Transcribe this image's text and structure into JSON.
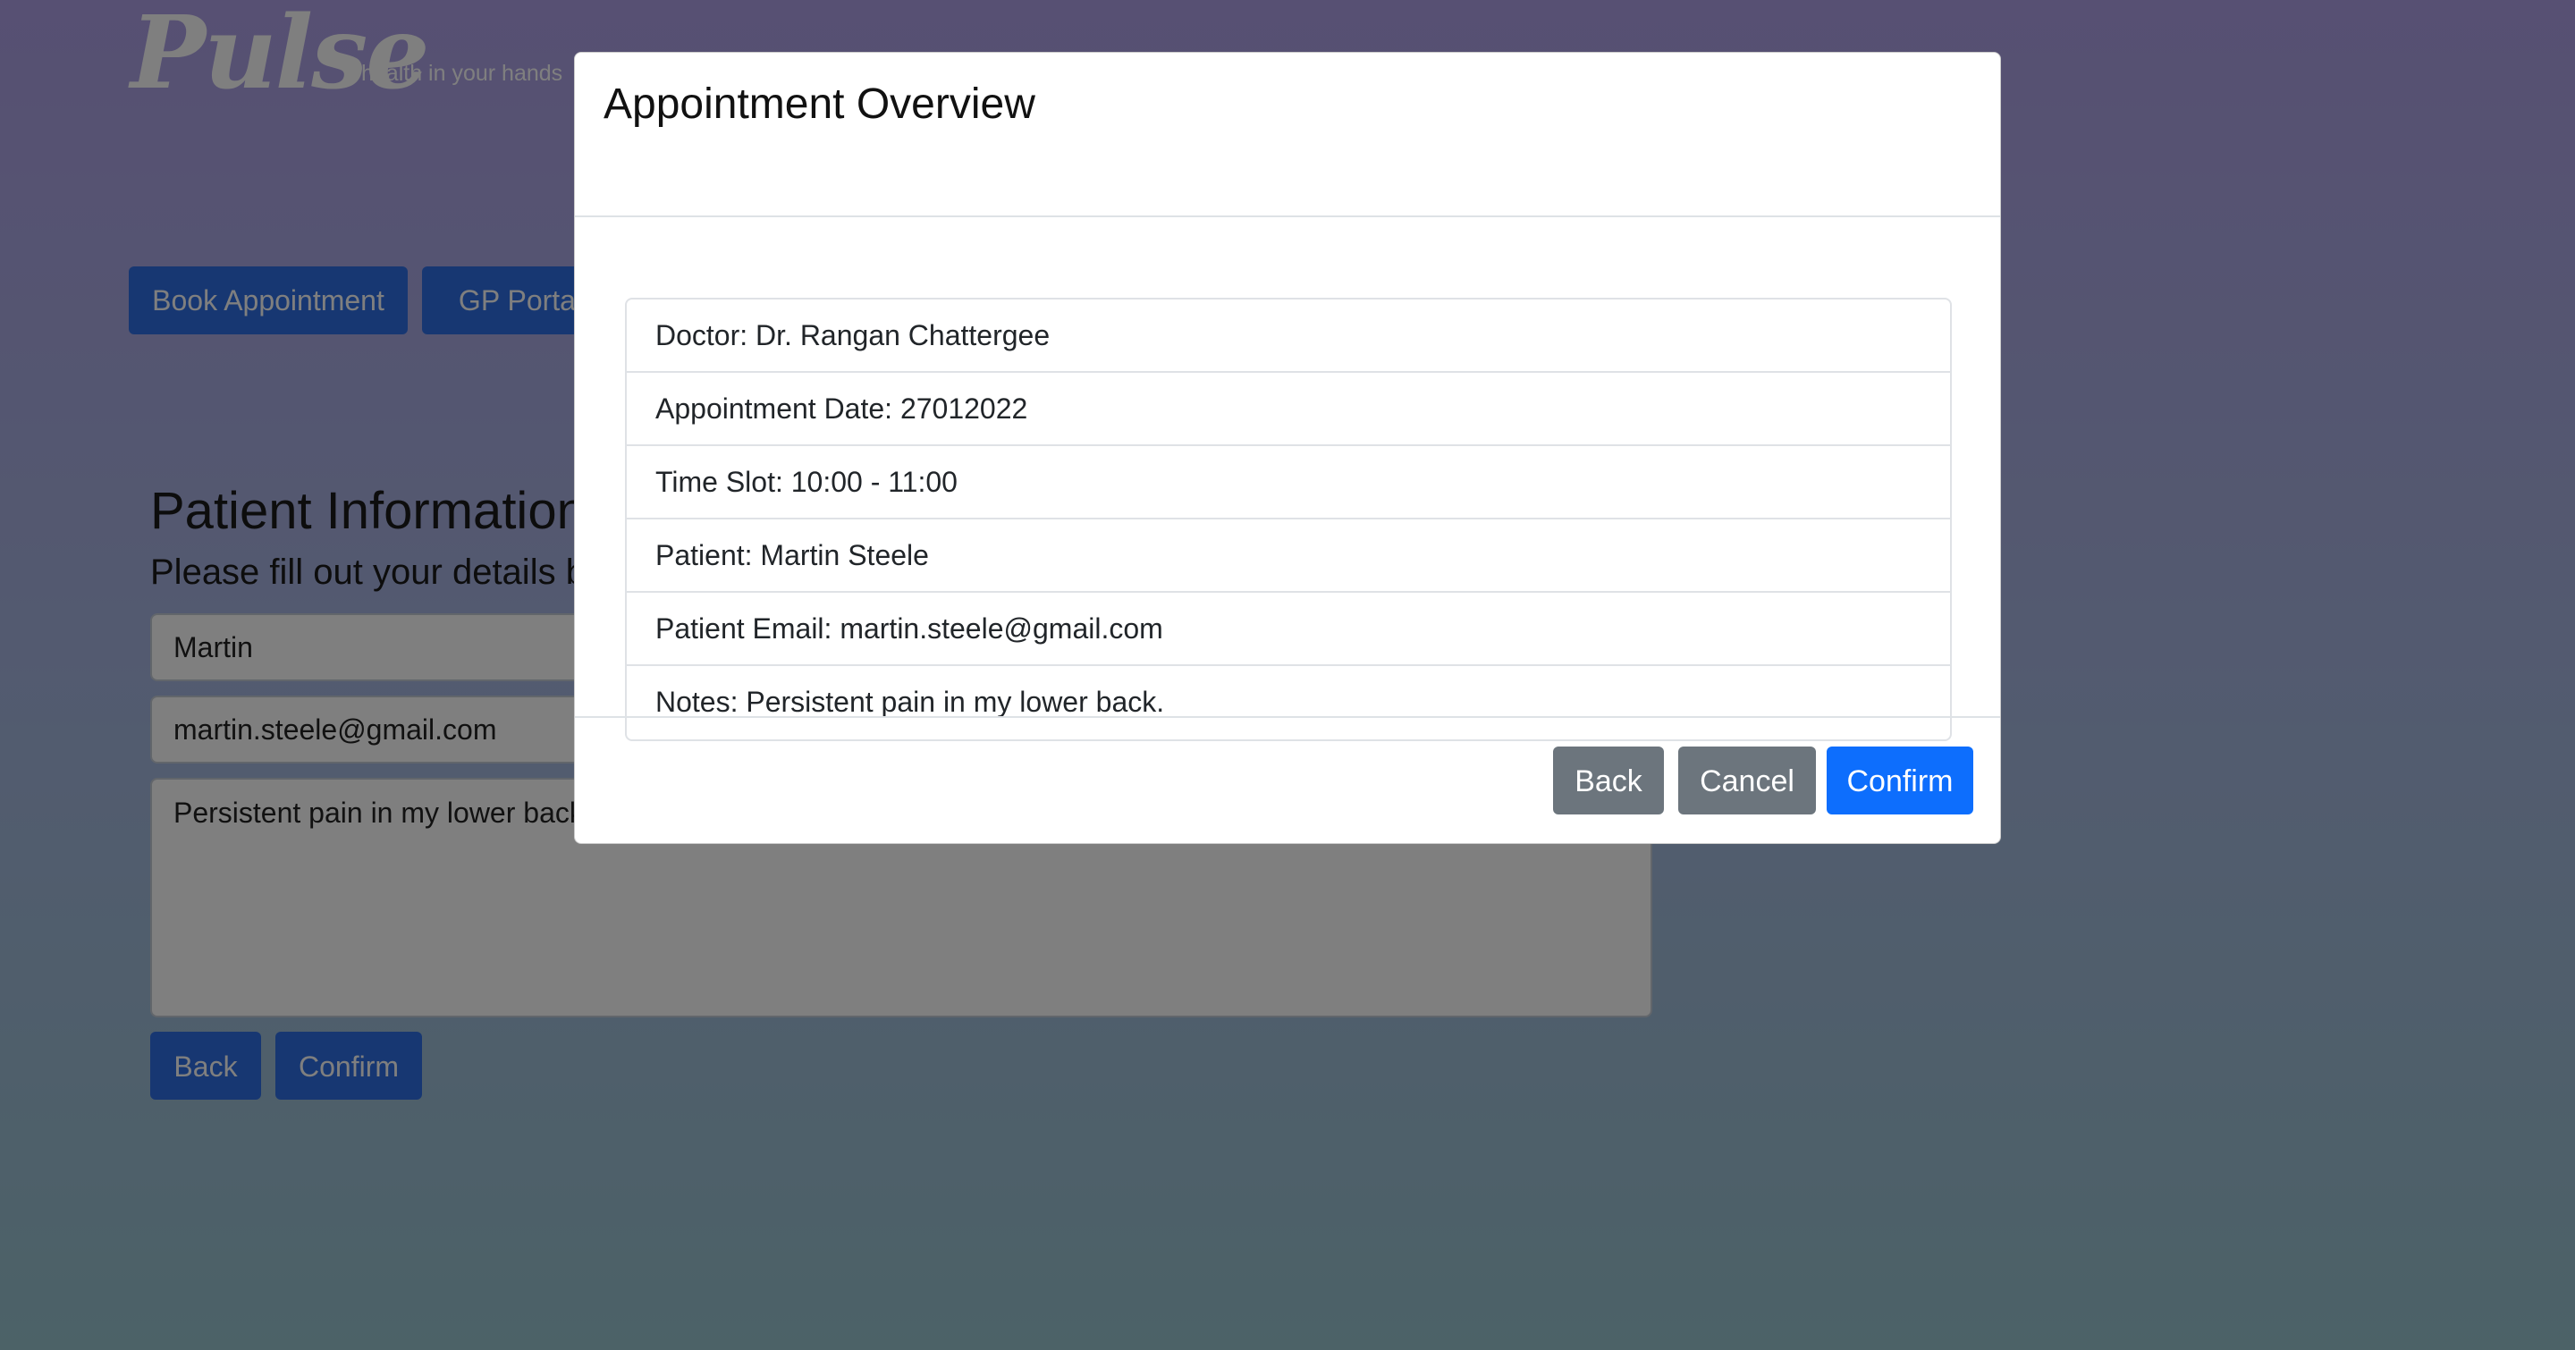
{
  "brand": {
    "logo": "Pulse",
    "tagline": "health in your hands"
  },
  "nav": {
    "book_label": "Book Appointment",
    "gp_label": "GP Portal"
  },
  "form": {
    "title": "Patient Information",
    "subtitle": "Please fill out your details b",
    "name_value": "Martin",
    "email_value": "martin.steele@gmail.com",
    "notes_value": "Persistent pain in my lower back.",
    "back_label": "Back",
    "confirm_label": "Confirm"
  },
  "modal": {
    "title": "Appointment Overview",
    "items": [
      "Doctor: Dr. Rangan Chattergee",
      "Appointment Date: 27012022",
      "Time Slot: 10:00 - 11:00",
      "Patient: Martin Steele",
      "Patient Email: martin.steele@gmail.com",
      "Notes: Persistent pain in my lower back."
    ],
    "back_label": "Back",
    "cancel_label": "Cancel",
    "confirm_label": "Confirm"
  }
}
